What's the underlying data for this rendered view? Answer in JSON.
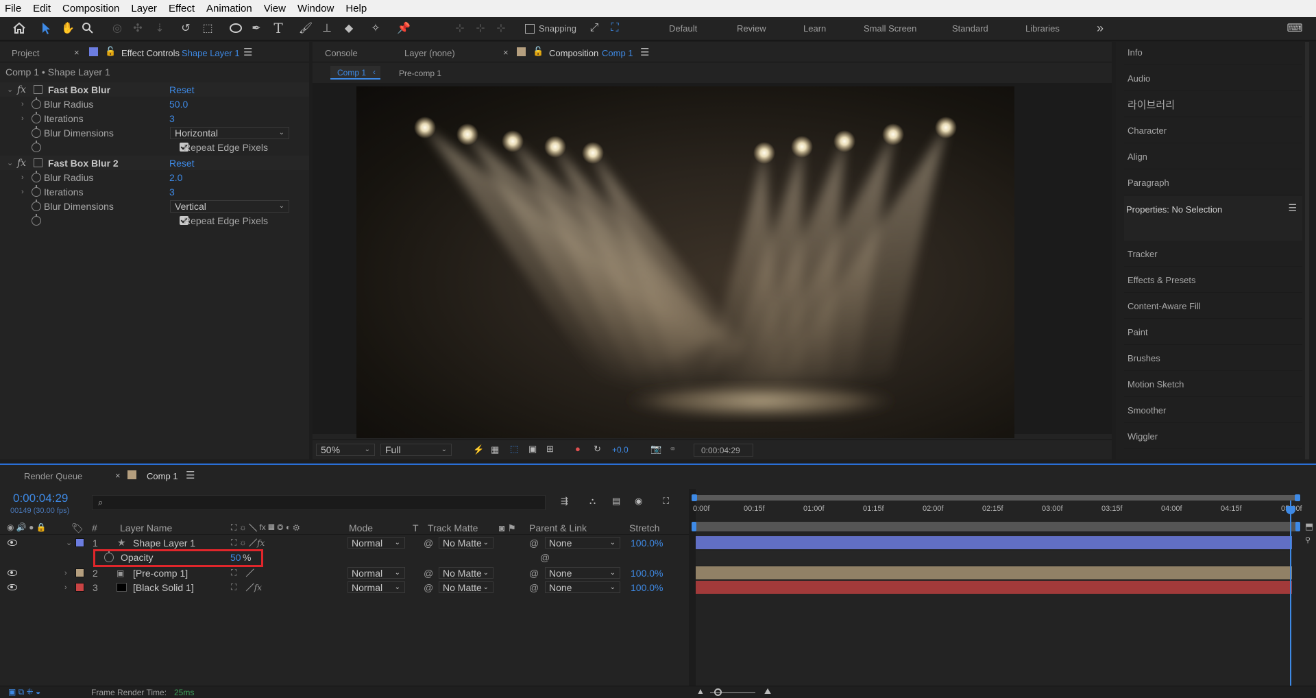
{
  "menu": [
    "File",
    "Edit",
    "Composition",
    "Layer",
    "Effect",
    "Animation",
    "View",
    "Window",
    "Help"
  ],
  "toolbar": {
    "snapping_label": "Snapping"
  },
  "workspaces": [
    "Default",
    "Review",
    "Learn",
    "Small Screen",
    "Standard",
    "Libraries"
  ],
  "left_panel": {
    "tab_project": "Project",
    "tab_effect_controls": "Effect Controls",
    "tab_effect_layer": "Shape Layer 1",
    "breadcrumb": "Comp 1 • Shape Layer 1",
    "effects": [
      {
        "name": "Fast Box Blur",
        "reset": "Reset",
        "radius_label": "Blur Radius",
        "radius": "50.0",
        "iter_label": "Iterations",
        "iter": "3",
        "dim_label": "Blur Dimensions",
        "dim": "Horizontal",
        "repeat_label": "Repeat Edge Pixels"
      },
      {
        "name": "Fast Box Blur 2",
        "reset": "Reset",
        "radius_label": "Blur Radius",
        "radius": "2.0",
        "iter_label": "Iterations",
        "iter": "3",
        "dim_label": "Blur Dimensions",
        "dim": "Vertical",
        "repeat_label": "Repeat Edge Pixels"
      }
    ]
  },
  "viewer": {
    "tab_console": "Console",
    "tab_layer": "Layer (none)",
    "tab_composition": "Composition",
    "tab_comp_name": "Comp 1",
    "crumb_comp": "Comp 1",
    "crumb_precomp": "Pre-comp 1",
    "zoom": "50%",
    "resolution": "Full",
    "exposure": "+0.0",
    "timecode": "0:00:04:29"
  },
  "right_panel": [
    "Info",
    "Audio",
    "라이브러리",
    "Character",
    "Align",
    "Paragraph",
    "Properties: No Selection",
    "Tracker",
    "Effects & Presets",
    "Content-Aware Fill",
    "Paint",
    "Brushes",
    "Motion Sketch",
    "Smoother",
    "Wiggler"
  ],
  "timeline": {
    "tab_render_queue": "Render Queue",
    "tab_comp": "Comp 1",
    "current_time": "0:00:04:29",
    "frame_info": "00149 (30.00 fps)",
    "search_placeholder": "",
    "headers": {
      "num": "#",
      "name": "Layer Name",
      "mode": "Mode",
      "t": "T",
      "track_matte": "Track Matte",
      "parent": "Parent & Link",
      "stretch": "Stretch"
    },
    "ruler": [
      "0:00f",
      "00:15f",
      "01:00f",
      "01:15f",
      "02:00f",
      "02:15f",
      "03:00f",
      "03:15f",
      "04:00f",
      "04:15f",
      "05:00f"
    ],
    "layers": [
      {
        "num": "1",
        "name": "Shape Layer 1",
        "mode": "Normal",
        "matte": "No Matte",
        "parent": "None",
        "stretch": "100.0%",
        "color": "#6c7de0"
      },
      {
        "num": "2",
        "name": "[Pre-comp 1]",
        "mode": "Normal",
        "matte": "No Matte",
        "parent": "None",
        "stretch": "100.0%",
        "color": "#b59f7f"
      },
      {
        "num": "3",
        "name": "[Black Solid 1]",
        "mode": "Normal",
        "matte": "No Matte",
        "parent": "None",
        "stretch": "100.0%",
        "color": "#c94444"
      }
    ],
    "opacity": {
      "label": "Opacity",
      "value": "50",
      "unit": "%"
    },
    "render_time_label": "Frame Render Time:",
    "render_time_value": "25ms"
  },
  "colors": {
    "accent": "#3e8ae6",
    "highlight_box": "#e0262b"
  }
}
